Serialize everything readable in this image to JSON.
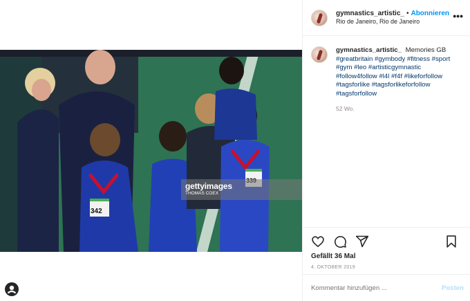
{
  "post": {
    "watermark_brand": "gettyimages",
    "watermark_credit": "THOMAS COEX",
    "bibs": [
      "342",
      "339"
    ]
  },
  "header": {
    "username": "gymnastics_artistic_",
    "separator": "•",
    "follow_label": "Abonnieren",
    "location": "Rio de Janeiro, Rio de Janeiro",
    "more_icon": "more-horizontal-icon"
  },
  "caption": {
    "username": "gymnastics_artistic_",
    "text": "Memories GB",
    "hashtags": "#greatbritain #gymbody #fitness #sport #gym #leo #artisticgymnastic #follow4follow #l4l #f4f #likeforfollow #tagsforlike #tagsforlikeforfollow #tagsforfollow",
    "time_ago": "52 Wo."
  },
  "actions": {
    "icons": [
      "heart-icon",
      "comment-icon",
      "share-icon",
      "bookmark-icon"
    ],
    "likes": "Gefällt 36 Mal",
    "date": "4. OKTOBER 2019"
  },
  "comment": {
    "placeholder": "Kommentar hinzufügen ...",
    "post_label": "Posten"
  },
  "colors": {
    "accent": "#0095f6",
    "post_disabled": "#b2dffc",
    "hashtag": "#00376b",
    "muted": "#8e8e8e"
  }
}
